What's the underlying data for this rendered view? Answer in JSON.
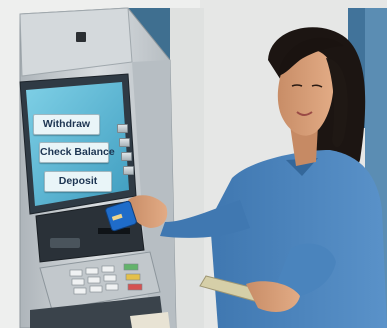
{
  "atm": {
    "buttons": [
      {
        "label": "Withdraw"
      },
      {
        "label": "Check Balance"
      },
      {
        "label": "Deposit"
      }
    ]
  },
  "colors": {
    "atm_body": "#c9ced2",
    "screen": "#59b4d1",
    "card": "#1f6cc9",
    "shirt": "#4a84bd",
    "wall": "#ecedec",
    "pillar": "#3e6f8f"
  }
}
